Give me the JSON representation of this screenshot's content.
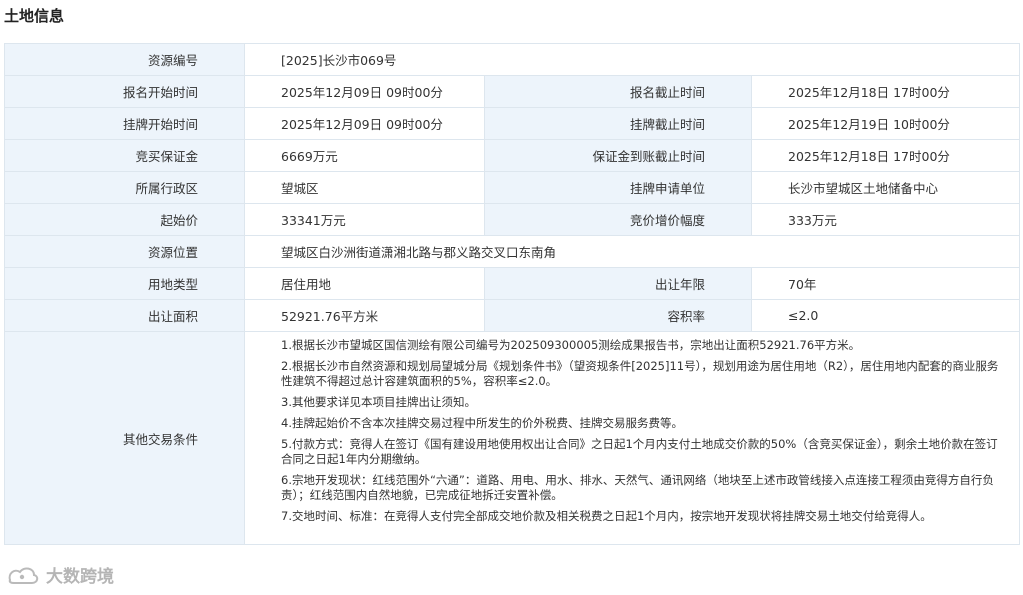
{
  "title": "土地信息",
  "rows": {
    "resource_no": {
      "label": "资源编号",
      "value": "[2025]长沙市069号"
    },
    "signup_start": {
      "label": "报名开始时间",
      "value": "2025年12月09日 09时00分"
    },
    "signup_end": {
      "label": "报名截止时间",
      "value": "2025年12月18日 17时00分"
    },
    "listing_start": {
      "label": "挂牌开始时间",
      "value": "2025年12月09日 09时00分"
    },
    "listing_end": {
      "label": "挂牌截止时间",
      "value": "2025年12月19日 10时00分"
    },
    "deposit": {
      "label": "竞买保证金",
      "value": "6669万元"
    },
    "deposit_deadline": {
      "label": "保证金到账截止时间",
      "value": "2025年12月18日 17时00分"
    },
    "district": {
      "label": "所属行政区",
      "value": "望城区"
    },
    "applicant_unit": {
      "label": "挂牌申请单位",
      "value": "长沙市望城区土地储备中心"
    },
    "start_price": {
      "label": "起始价",
      "value": "33341万元"
    },
    "bid_increment": {
      "label": "竞价增价幅度",
      "value": "333万元"
    },
    "location": {
      "label": "资源位置",
      "value": "望城区白沙洲街道潇湘北路与郡义路交叉口东南角"
    },
    "land_use": {
      "label": "用地类型",
      "value": "居住用地"
    },
    "term": {
      "label": "出让年限",
      "value": "70年"
    },
    "area": {
      "label": "出让面积",
      "value": "52921.76平方米"
    },
    "far": {
      "label": "容积率",
      "value": "≤2.0"
    }
  },
  "conditions": {
    "label": "其他交易条件",
    "items": [
      "1.根据长沙市望城区国信测绘有限公司编号为202509300005测绘成果报告书，宗地出让面积52921.76平方米。",
      "2.根据长沙市自然资源和规划局望城分局《规划条件书》（望资规条件[2025]11号），规划用途为居住用地（R2），居住用地内配套的商业服务性建筑不得超过总计容建筑面积的5%，容积率≤2.0。",
      "3.其他要求详见本项目挂牌出让须知。",
      "4.挂牌起始价不含本次挂牌交易过程中所发生的价外税费、挂牌交易服务费等。",
      "5.付款方式：竞得人在签订《国有建设用地使用权出让合同》之日起1个月内支付土地成交价款的50%（含竞买保证金），剩余土地价款在签订合同之日起1年内分期缴纳。",
      "6.宗地开发现状：红线范围外“六通”：道路、用电、用水、排水、天然气、通讯网络（地块至上述市政管线接入点连接工程须由竞得方自行负责）；红线范围内自然地貌，已完成征地拆迁安置补偿。",
      "7.交地时间、标准：在竞得人支付完全部成交地价款及相关税费之日起1个月内，按宗地开发现状将挂牌交易土地交付给竞得人。"
    ]
  },
  "watermark": {
    "text": "大数跨境",
    "icon": "brand-logo-icon"
  }
}
